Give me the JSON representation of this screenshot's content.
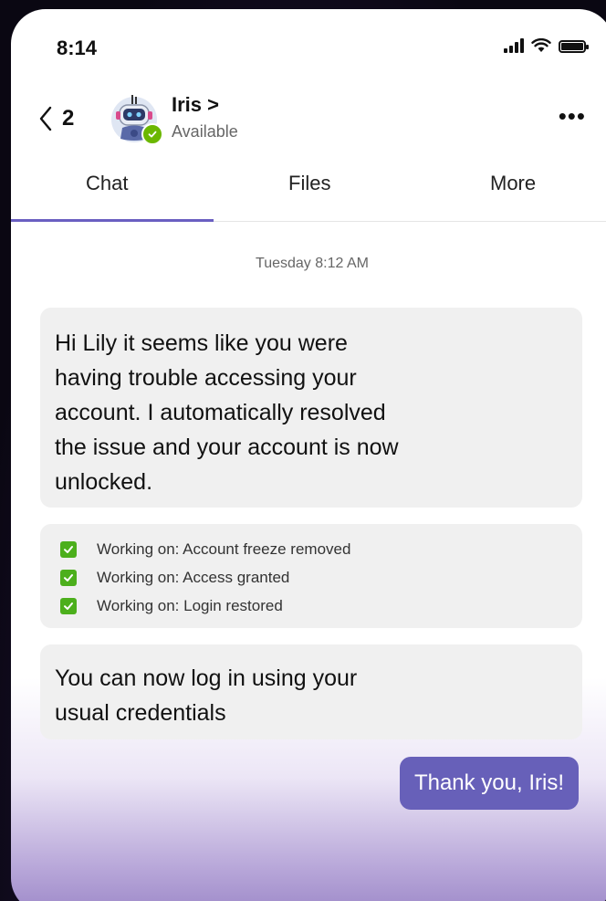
{
  "status_bar": {
    "time": "8:14",
    "icons": [
      "cellular-signal-icon",
      "wifi-icon",
      "battery-icon"
    ]
  },
  "header": {
    "back_count": "2",
    "contact_name": "Iris >",
    "contact_status": "Available",
    "more_label": "•••",
    "avatar": "robot-avatar-icon",
    "presence_color": "#6bb700"
  },
  "tabs": [
    {
      "label": "Chat",
      "active": true
    },
    {
      "label": "Files",
      "active": false
    },
    {
      "label": "More",
      "active": false
    }
  ],
  "conversation": {
    "day_stamp": "Tuesday 8:12 AM",
    "messages": [
      {
        "text": "Hi Lily it seems like you were\nhaving trouble accessing your\naccount. I automatically resolved\nthe issue and your account is now\nunlocked."
      },
      {
        "checklist": [
          "Working on: Account freeze removed",
          "Working on: Access granted",
          "Working on: Login restored"
        ]
      },
      {
        "text": "You can now log in using your\nusual credentials"
      }
    ],
    "reply": "Thank you, Iris!"
  },
  "colors": {
    "accent": "#6a5fc1",
    "reply_bubble": "#6760b9",
    "bubble_bg": "#f0f0f0",
    "check_green": "#4caf1c"
  }
}
